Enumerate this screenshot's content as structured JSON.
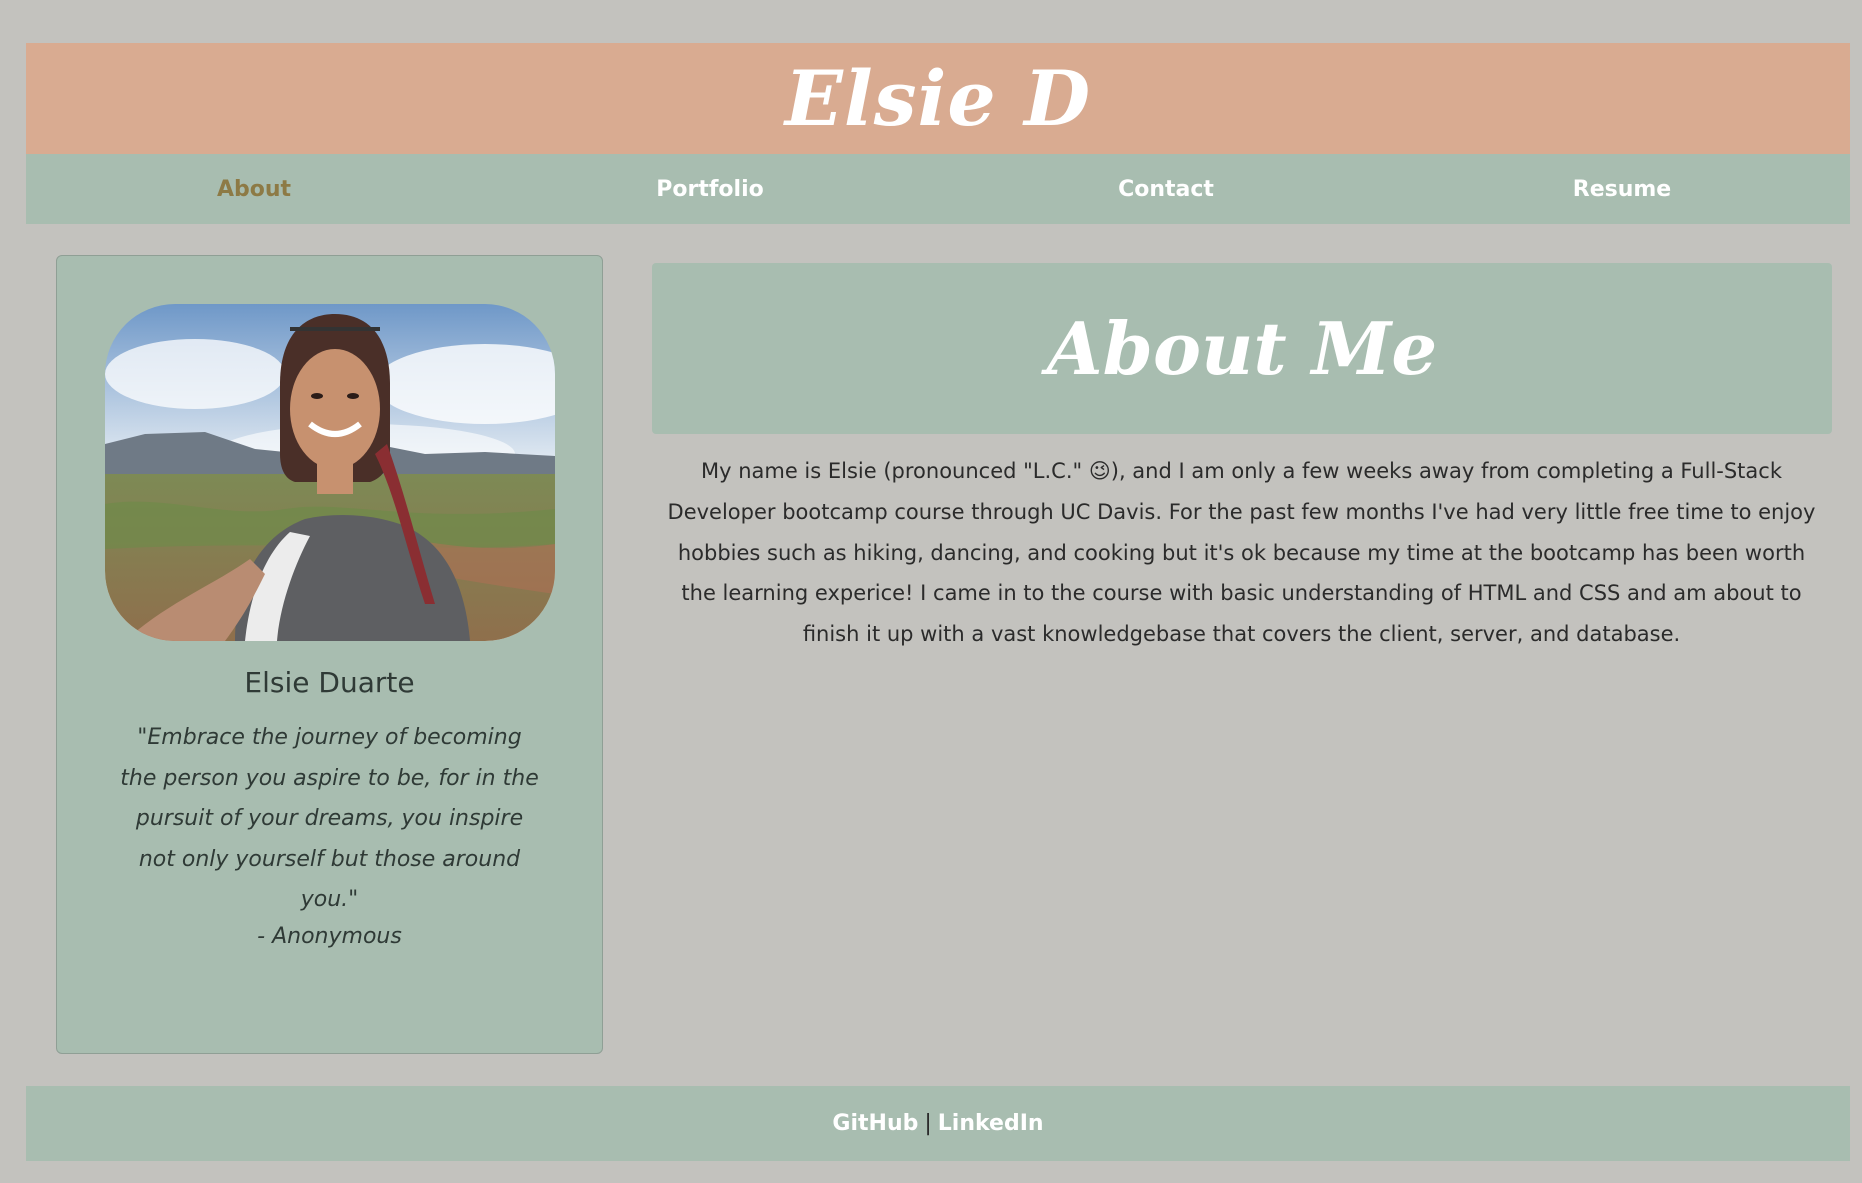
{
  "site": {
    "title": "Elsie D"
  },
  "nav": {
    "items": [
      {
        "label": "About",
        "active": true
      },
      {
        "label": "Portfolio",
        "active": false
      },
      {
        "label": "Contact",
        "active": false
      },
      {
        "label": "Resume",
        "active": false
      }
    ]
  },
  "profile": {
    "photo_alt": "Elsie Duarte selfie",
    "name": "Elsie Duarte",
    "quote": "\"Embrace the journey of becoming the person you aspire to be, for in the pursuit of your dreams, you inspire not only yourself but those around you.\"",
    "author": "- Anonymous"
  },
  "about": {
    "title": "About Me",
    "text": "My name is Elsie (pronounced \"L.C.\" 😉), and I am only a few weeks away from completing a Full-Stack Developer bootcamp course through UC Davis. For the past few months I've had very little free time to enjoy hobbies such as hiking, dancing, and cooking but it's ok because my time at the bootcamp has been worth the learning experice! I came in to the course with basic understanding of HTML and CSS and am about to finish it up with a vast knowledgebase that covers the client, server, and database."
  },
  "footer": {
    "links": [
      {
        "label": "GitHub"
      },
      {
        "label": "LinkedIn"
      }
    ],
    "separator": "|"
  },
  "colors": {
    "page_bg": "#c3c2be",
    "header_bg": "#d9ab91",
    "panel_bg": "#a8bdb0",
    "active_nav": "#8d7a45",
    "text": "#2b2b2b",
    "light_text": "#ffffff"
  }
}
